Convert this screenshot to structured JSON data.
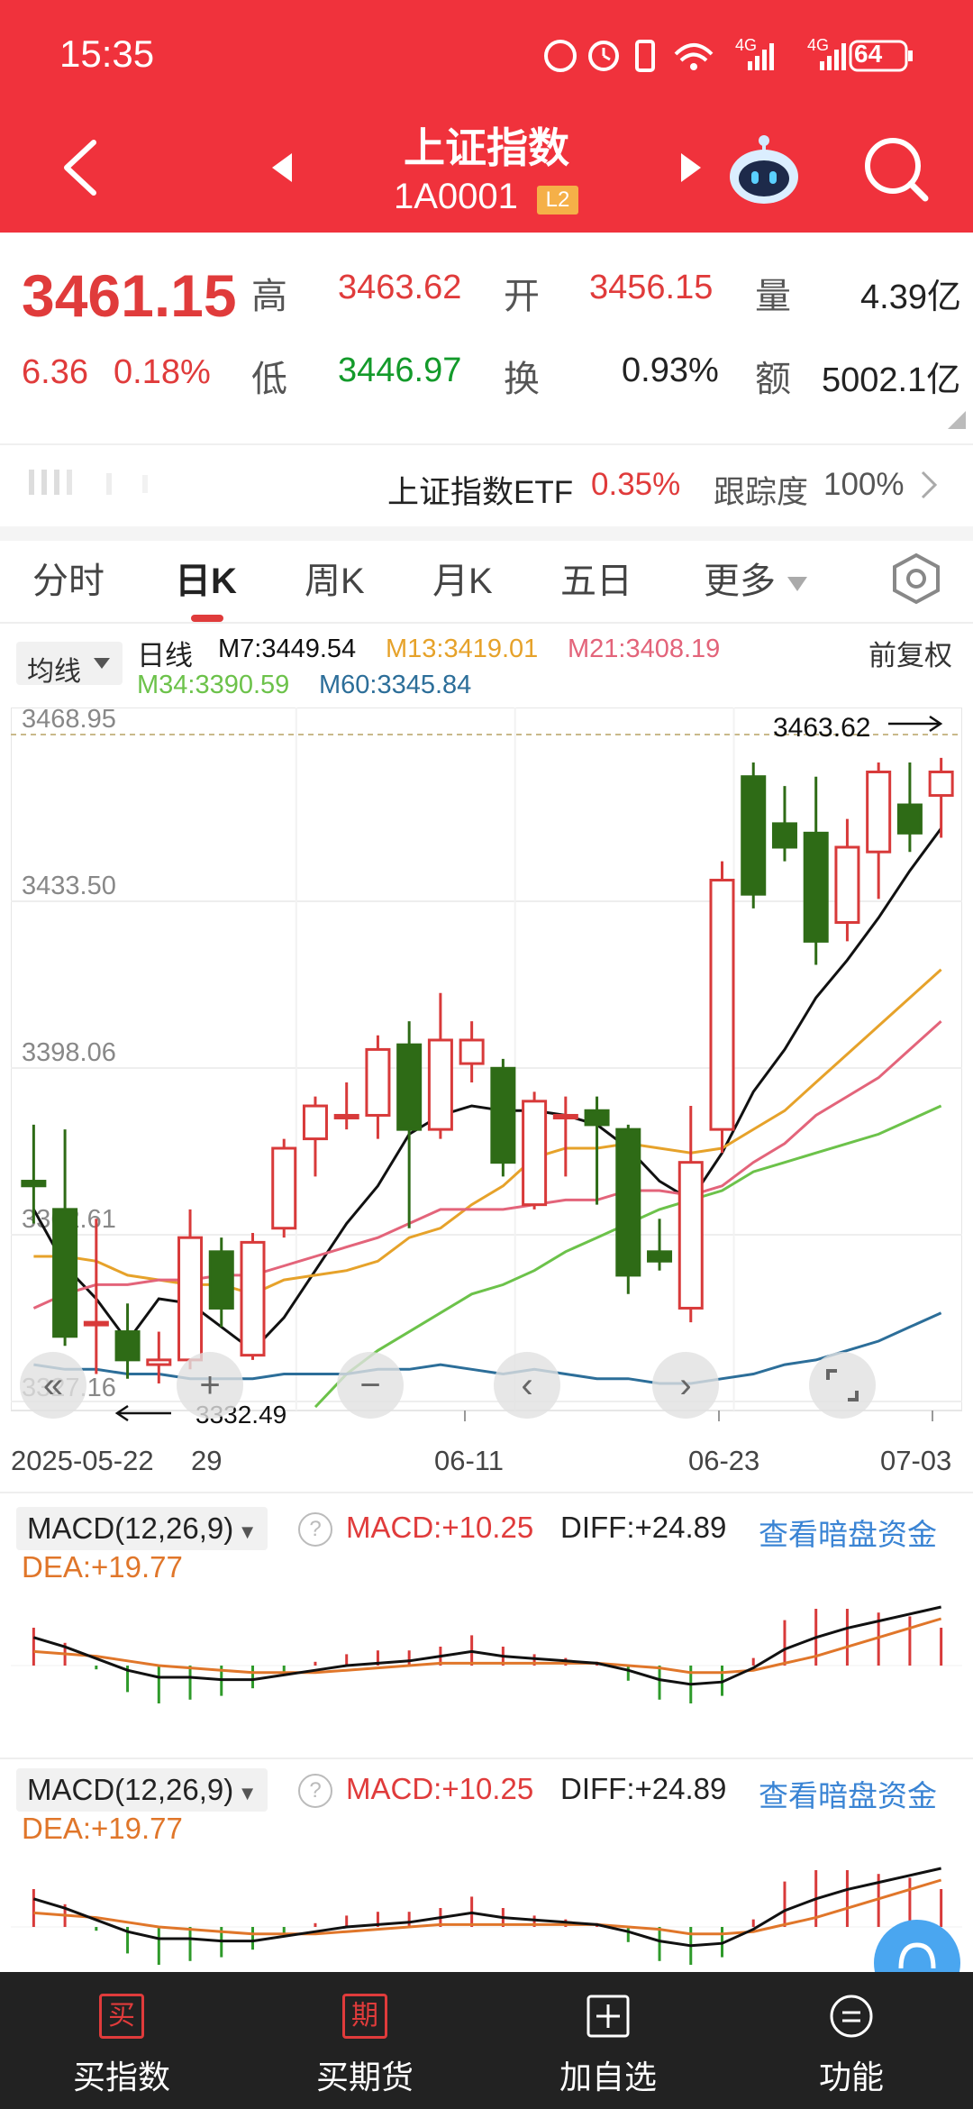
{
  "status": {
    "time": "15:35",
    "network1": "4G",
    "network2": "4G",
    "battery": "64"
  },
  "header": {
    "title": "上证指数",
    "code": "1A0001",
    "level_badge": "L2"
  },
  "quote": {
    "price": "3461.15",
    "change": "6.36",
    "change_pct": "0.18%",
    "high_label": "高",
    "high": "3463.62",
    "open_label": "开",
    "open": "3456.15",
    "volume_label": "量",
    "volume": "4.39亿",
    "low_label": "低",
    "low": "3446.97",
    "turnover_label": "换",
    "turnover": "0.93%",
    "amount_label": "额",
    "amount": "5002.1亿"
  },
  "etf": {
    "name": "上证指数ETF",
    "pct": "0.35%",
    "track_label": "跟踪度",
    "track": "100%"
  },
  "tabs": [
    "分时",
    "日K",
    "周K",
    "月K",
    "五日",
    "更多"
  ],
  "active_tab": "日K",
  "ma": {
    "selector": "均线",
    "period": "日线",
    "m7": "M7:3449.54",
    "m13": "M13:3419.01",
    "m21": "M21:3408.19",
    "m34": "M34:3390.59",
    "m60": "M60:3345.84",
    "adjust": "前复权"
  },
  "chart_data": {
    "type": "candlestick",
    "y_ticks": [
      "3468.95",
      "3433.50",
      "3398.06",
      "3362.61",
      "3327.16"
    ],
    "x_ticks": [
      "2025-05-22",
      "29",
      "06-11",
      "06-23",
      "07-03"
    ],
    "ylim": [
      3327.16,
      3468.95
    ],
    "high_marker": "3463.62",
    "low_marker": "3332.49",
    "candles": [
      {
        "o": 3374,
        "c": 3373,
        "h": 3386,
        "l": 3365
      },
      {
        "o": 3368,
        "c": 3341,
        "h": 3385,
        "l": 3339
      },
      {
        "o": 3344,
        "c": 3344,
        "h": 3366,
        "l": 3333
      },
      {
        "o": 3342,
        "c": 3336,
        "h": 3348,
        "l": 3332
      },
      {
        "o": 3335,
        "c": 3336,
        "h": 3342,
        "l": 3331
      },
      {
        "o": 3336,
        "c": 3362,
        "h": 3368,
        "l": 3334
      },
      {
        "o": 3359,
        "c": 3347,
        "h": 3362,
        "l": 3343
      },
      {
        "o": 3337,
        "c": 3361,
        "h": 3363,
        "l": 3336
      },
      {
        "o": 3364,
        "c": 3381,
        "h": 3383,
        "l": 3362
      },
      {
        "o": 3383,
        "c": 3390,
        "h": 3392,
        "l": 3375
      },
      {
        "o": 3388,
        "c": 3388,
        "h": 3395,
        "l": 3385
      },
      {
        "o": 3388,
        "c": 3402,
        "h": 3405,
        "l": 3383
      },
      {
        "o": 3403,
        "c": 3385,
        "h": 3408,
        "l": 3364
      },
      {
        "o": 3385,
        "c": 3404,
        "h": 3414,
        "l": 3383
      },
      {
        "o": 3399,
        "c": 3404,
        "h": 3408,
        "l": 3395
      },
      {
        "o": 3398,
        "c": 3378,
        "h": 3400,
        "l": 3375
      },
      {
        "o": 3369,
        "c": 3391,
        "h": 3393,
        "l": 3368
      },
      {
        "o": 3388,
        "c": 3388,
        "h": 3392,
        "l": 3375
      },
      {
        "o": 3389,
        "c": 3386,
        "h": 3392,
        "l": 3369
      },
      {
        "o": 3385,
        "c": 3354,
        "h": 3386,
        "l": 3350
      },
      {
        "o": 3359,
        "c": 3357,
        "h": 3366,
        "l": 3355
      },
      {
        "o": 3347,
        "c": 3378,
        "h": 3390,
        "l": 3344
      },
      {
        "o": 3385,
        "c": 3438,
        "h": 3442,
        "l": 3380
      },
      {
        "o": 3460,
        "c": 3435,
        "h": 3463,
        "l": 3432
      },
      {
        "o": 3450,
        "c": 3445,
        "h": 3458,
        "l": 3442
      },
      {
        "o": 3448,
        "c": 3425,
        "h": 3460,
        "l": 3420
      },
      {
        "o": 3429,
        "c": 3445,
        "h": 3451,
        "l": 3425
      },
      {
        "o": 3444,
        "c": 3461,
        "h": 3463,
        "l": 3434
      },
      {
        "o": 3454,
        "c": 3448,
        "h": 3463,
        "l": 3444
      },
      {
        "o": 3456,
        "c": 3461,
        "h": 3464,
        "l": 3447
      }
    ],
    "series": [
      {
        "color": "#111111",
        "values": [
          3368,
          3356,
          3349,
          3340,
          3349,
          3348,
          3343,
          3338,
          3345,
          3355,
          3365,
          3373,
          3384,
          3388,
          3390,
          3389,
          3389,
          3388,
          3386,
          3381,
          3374,
          3370,
          3380,
          3393,
          3402,
          3413,
          3421,
          3430,
          3440,
          3449
        ]
      },
      {
        "color": "#e6a22a",
        "values": [
          3358,
          3358,
          3357,
          3354,
          3353,
          3352,
          3352,
          3350,
          3353,
          3354,
          3355,
          3357,
          3362,
          3364,
          3369,
          3373,
          3379,
          3381,
          3381,
          3382,
          3381,
          3380,
          3381,
          3385,
          3389,
          3395,
          3401,
          3407,
          3413,
          3419
        ]
      },
      {
        "color": "#e3647a",
        "values": [
          3347,
          3350,
          3352,
          3352,
          3353,
          3353,
          3354,
          3354,
          3356,
          3358,
          3360,
          3362,
          3365,
          3368,
          3368,
          3368,
          3369,
          3370,
          3370,
          3372,
          3372,
          3371,
          3373,
          3378,
          3382,
          3388,
          3392,
          3396,
          3402,
          3408
        ]
      },
      {
        "color": "#6cc24a",
        "values": [
          null,
          null,
          null,
          null,
          null,
          null,
          null,
          null,
          null,
          3326,
          3333,
          3338,
          3342,
          3346,
          3350,
          3352,
          3355,
          3359,
          3362,
          3365,
          3368,
          3370,
          3372,
          3376,
          3378,
          3380,
          3382,
          3384,
          3387,
          3390
        ]
      },
      {
        "color": "#2c6e99",
        "values": [
          3335,
          3334,
          3334,
          3333,
          3333,
          3332,
          3332,
          3332,
          3333,
          3333,
          3333,
          3334,
          3334,
          3335,
          3334,
          3333,
          3334,
          3333,
          3332,
          3332,
          3331,
          3331,
          3332,
          3333,
          3335,
          3336,
          3338,
          3340,
          3343,
          3346
        ]
      }
    ]
  },
  "macd": {
    "label": "MACD(12,26,9)",
    "macd": "MACD:+10.25",
    "diff": "DIFF:+24.89",
    "dea": "DEA:+19.77",
    "link": "查看暗盘资金",
    "diff_values": [
      12,
      8,
      3,
      -2,
      -5,
      -5,
      -6,
      -6,
      -4,
      -2,
      0,
      1,
      2,
      4,
      6,
      4,
      3,
      2,
      1,
      -2,
      -6,
      -8,
      -7,
      -1,
      7,
      12,
      16,
      19,
      22,
      25
    ],
    "dea_values": [
      6,
      5,
      4,
      2,
      0,
      -1,
      -2,
      -3,
      -3,
      -3,
      -2,
      -1,
      0,
      1,
      1,
      1,
      1,
      1,
      1,
      0,
      -1,
      -3,
      -3,
      -2,
      1,
      4,
      8,
      12,
      16,
      20
    ],
    "bars": [
      10,
      6,
      -1,
      -7,
      -10,
      -9,
      -8,
      -6,
      -2,
      1,
      3,
      4,
      4,
      5,
      8,
      5,
      3,
      2,
      1,
      -4,
      -9,
      -10,
      -8,
      2,
      12,
      15,
      15,
      14,
      13,
      10
    ]
  },
  "bottom_nav": [
    {
      "icon": "买",
      "label": "买指数"
    },
    {
      "icon": "期",
      "label": "买期货"
    },
    {
      "icon": "plus",
      "label": "加自选"
    },
    {
      "icon": "menu",
      "label": "功能"
    }
  ]
}
